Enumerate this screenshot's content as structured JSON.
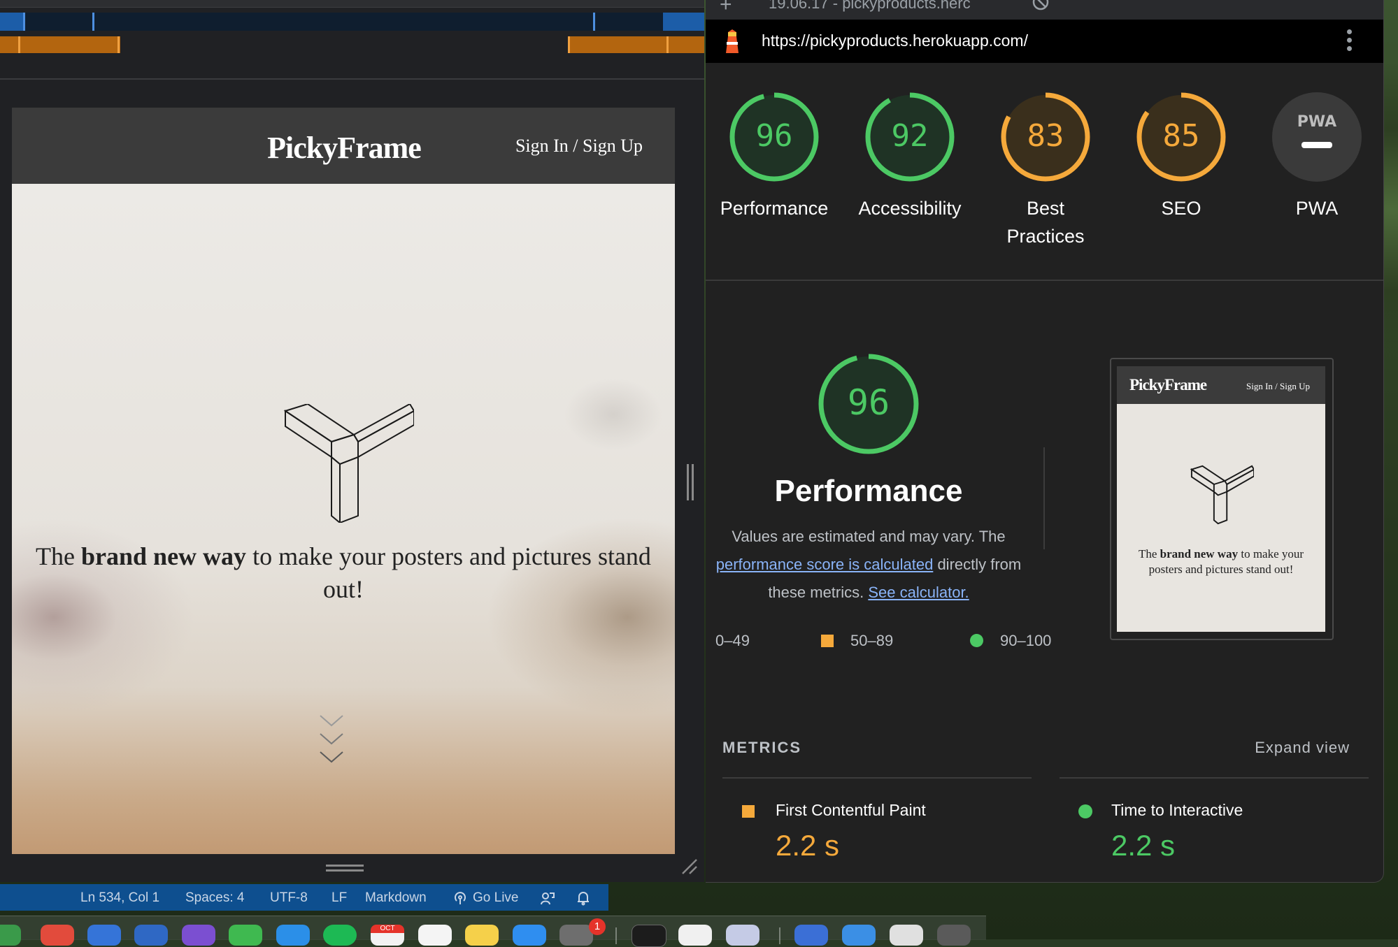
{
  "statusbar": {
    "position": "Ln 534, Col 1",
    "spaces": "Spaces: 4",
    "encoding": "UTF-8",
    "eol": "LF",
    "language": "Markdown",
    "go_live": "Go Live"
  },
  "page_preview": {
    "logo": "PickyFrame",
    "signin": "Sign In / Sign Up",
    "tagline_pre": "The ",
    "tagline_bold": "brand new way",
    "tagline_post": " to make your posters and pictures stand out!"
  },
  "browser": {
    "tab_title": "19.06.17 - pickyproducts.herc",
    "new_tab": "+",
    "url": "https://pickyproducts.herokuapp.com/"
  },
  "lighthouse": {
    "categories": [
      {
        "label": "Performance",
        "score": "96",
        "color": "#4cc964"
      },
      {
        "label": "Accessibility",
        "score": "92",
        "color": "#4cc964"
      },
      {
        "label_line1": "Best",
        "label_line2": "Practices",
        "score": "83",
        "color": "#f5a93b"
      },
      {
        "label": "SEO",
        "score": "85",
        "color": "#f5a93b"
      },
      {
        "label": "PWA",
        "badge": "PWA"
      }
    ],
    "performance": {
      "score": "96",
      "title": "Performance",
      "desc_line1": "Values are estimated and may vary. The",
      "desc_link1": "performance score is calculated",
      "desc_line2_tail": " directly from",
      "desc_line3": "these metrics. ",
      "desc_link2": "See calculator."
    },
    "legend": [
      {
        "range": "0–49",
        "color": "#e5553f"
      },
      {
        "range": "50–89",
        "color": "#f5a93b"
      },
      {
        "range": "90–100",
        "color": "#4cc964"
      }
    ],
    "thumbnail": {
      "logo": "PickyFrame",
      "signin": "Sign In / Sign Up",
      "tagline_pre": "The ",
      "tagline_bold": "brand new way",
      "tagline_post": " to make your posters and pictures stand out!"
    },
    "metrics": {
      "heading": "METRICS",
      "expand": "Expand view",
      "items": [
        {
          "name": "First Contentful Paint",
          "value": "2.2 s",
          "color": "#f5a93b"
        },
        {
          "name": "Time to Interactive",
          "value": "2.2 s",
          "color": "#4cc964"
        }
      ]
    }
  },
  "dock": {
    "badge": "1",
    "calendar_month": "OCT"
  }
}
